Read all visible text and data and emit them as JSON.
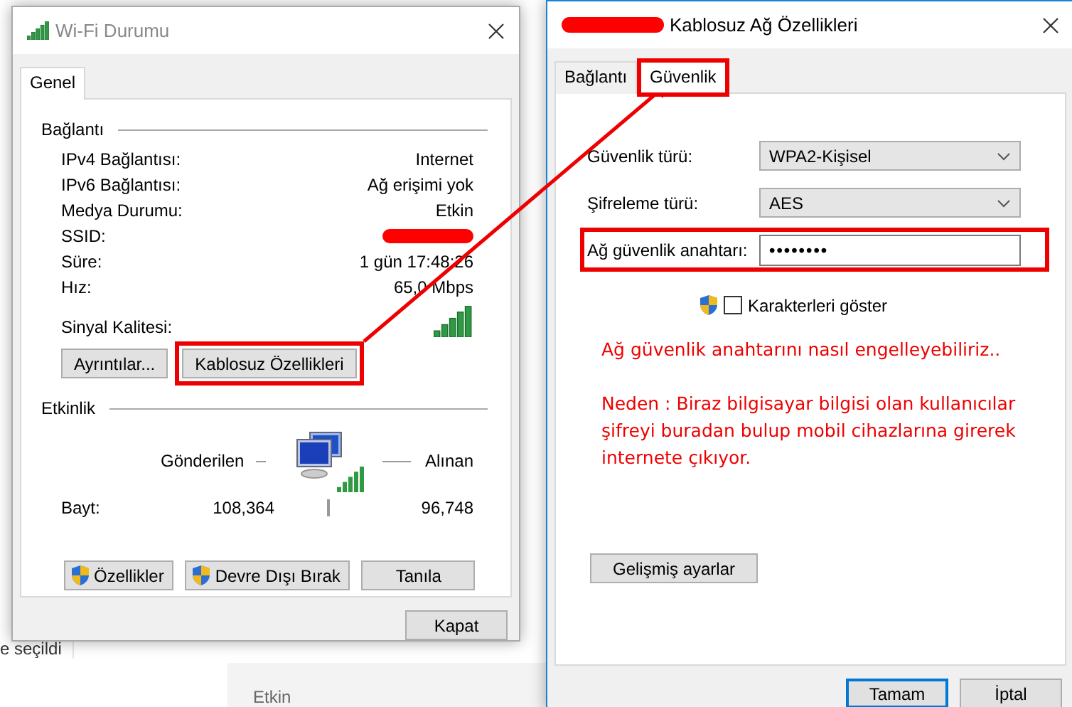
{
  "background": {
    "texts": [
      "e seçildi",
      "Etkin"
    ]
  },
  "status_window": {
    "title": "Wi-Fi Durumu",
    "tabs": [
      {
        "label": "Genel",
        "selected": true
      }
    ],
    "connection": {
      "heading": "Bağlantı",
      "rows": [
        {
          "label": "IPv4 Bağlantısı:",
          "value": "Internet",
          "redacted": false
        },
        {
          "label": "IPv6 Bağlantısı:",
          "value": "Ağ erişimi yok",
          "redacted": false
        },
        {
          "label": "Medya Durumu:",
          "value": "Etkin",
          "redacted": false
        },
        {
          "label": "SSID:",
          "redacted": true
        },
        {
          "label": "Süre:",
          "value": "1 gün 17:48:26",
          "redacted": false
        },
        {
          "label": "Hız:",
          "value": "65,0 Mbps",
          "redacted": false
        }
      ],
      "signal_label": "Sinyal Kalitesi:"
    },
    "buttons": [
      {
        "label": "Ayrıntılar...",
        "highlighted": false
      },
      {
        "label": "Kablosuz Özellikleri",
        "highlighted": true
      }
    ],
    "activity": {
      "heading": "Etkinlik",
      "sent_label": "Gönderilen",
      "received_label": "Alınan",
      "bytes_label": "Bayt:",
      "sent": "108,364",
      "received": "96,748"
    },
    "action_buttons": [
      {
        "label": "Özellikler",
        "kind": "shield"
      },
      {
        "label": "Devre Dışı Bırak",
        "kind": "shield"
      },
      {
        "label": "Tanıla",
        "kind": "plain"
      }
    ],
    "close_button": "Kapat"
  },
  "properties_window": {
    "title": "Kablosuz Ağ Özellikleri",
    "title_redacted": true,
    "tabs": [
      {
        "label": "Bağlantı",
        "selected": false,
        "highlighted": false
      },
      {
        "label": "Güvenlik",
        "selected": true,
        "highlighted": true
      }
    ],
    "fields": [
      {
        "label": "Güvenlik türü:",
        "value": "WPA2-Kişisel",
        "kind": "dropdown",
        "highlighted": false
      },
      {
        "label": "Şifreleme türü:",
        "value": "AES",
        "kind": "dropdown",
        "highlighted": false
      },
      {
        "label": "Ağ güvenlik anahtarı:",
        "value": "••••••••",
        "kind": "password",
        "highlighted": true
      }
    ],
    "show_characters": {
      "label": "Karakterleri göster",
      "checked": false
    },
    "notes": [
      "Ağ güvenlik anahtarını nasıl engelleyebiliriz..",
      "Neden : Biraz bilgisayar bilgisi olan kullanıcılar şifreyi buradan bulup mobil cihazlarına girerek internete çıkıyor."
    ],
    "advanced_button": "Gelişmiş ayarlar",
    "buttons": [
      {
        "label": "Tamam",
        "kind": "default"
      },
      {
        "label": "İptal",
        "kind": "normal"
      }
    ]
  }
}
